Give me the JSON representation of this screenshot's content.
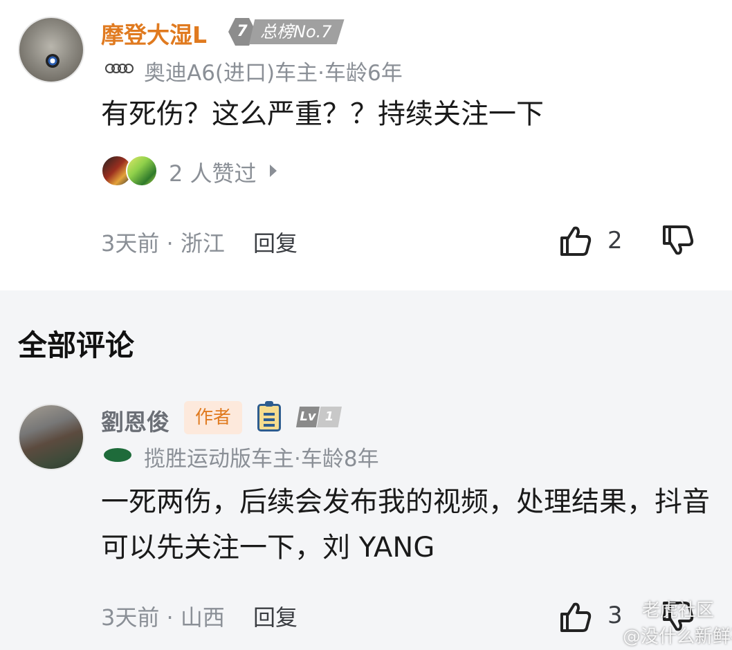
{
  "top_comment": {
    "username": "摩登大湿L",
    "rank_badge": {
      "number": "7",
      "text": "总榜No.7"
    },
    "car_info": "奥迪A6(进口)车主·车龄6年",
    "car_brand_icon": "audi-rings-icon",
    "text": "有死伤？这么严重？？持续关注一下",
    "likers_text": "2 人赞过",
    "meta": "3天前 · 浙江",
    "reply_label": "回复",
    "like_count": "2"
  },
  "section_title": "全部评论",
  "comments": [
    {
      "username": "劉恩俊",
      "author_badge": "作者",
      "level_badge": {
        "lv": "Lv",
        "level": "1"
      },
      "car_info": "揽胜运动版车主·车龄8年",
      "car_brand_icon": "land-rover-icon",
      "text": "一死两伤，后续会发布我的视频，处理结果，抖音可以先关注一下，刘 YANG",
      "meta": "3天前 · 山西",
      "reply_label": "回复",
      "like_count": "3"
    }
  ],
  "watermarks": [
    "老虎社区",
    "@没什么新鲜事视"
  ],
  "colors": {
    "username_orange": "#e07a1f",
    "meta_gray": "#8a8f96",
    "section_bg": "#f4f5f7"
  }
}
